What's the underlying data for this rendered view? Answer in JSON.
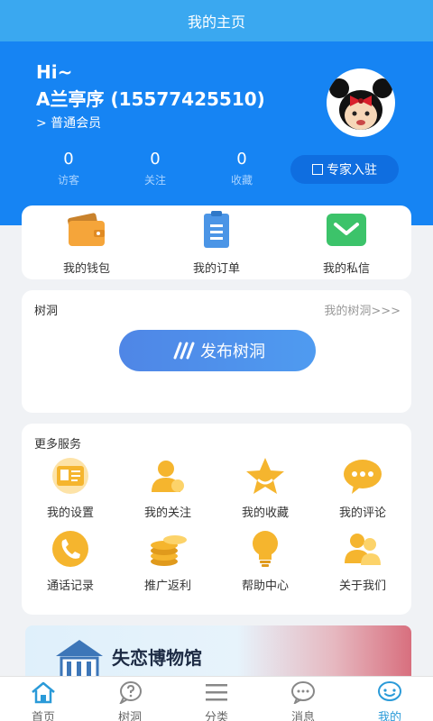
{
  "topbar": {
    "title": "我的主页"
  },
  "profile": {
    "greeting": "Hi~",
    "name": "A兰亭序 (15577425510)",
    "membership": "> 普通会员",
    "stats": [
      {
        "value": "0",
        "label": "访客"
      },
      {
        "value": "0",
        "label": "关注"
      },
      {
        "value": "0",
        "label": "收藏"
      }
    ],
    "expert_button": "专家入驻"
  },
  "quick": [
    {
      "label": "我的钱包",
      "icon": "wallet-icon"
    },
    {
      "label": "我的订单",
      "icon": "clipboard-icon"
    },
    {
      "label": "我的私信",
      "icon": "envelope-icon"
    }
  ],
  "treehole": {
    "title": "树洞",
    "link": "我的树洞>>>",
    "publish_button": "发布树洞"
  },
  "services": {
    "title": "更多服务",
    "items": [
      {
        "label": "我的设置",
        "icon": "id-card-icon"
      },
      {
        "label": "我的关注",
        "icon": "user-icon"
      },
      {
        "label": "我的收藏",
        "icon": "star-icon"
      },
      {
        "label": "我的评论",
        "icon": "comment-icon"
      },
      {
        "label": "通话记录",
        "icon": "phone-icon"
      },
      {
        "label": "推广返利",
        "icon": "coins-icon"
      },
      {
        "label": "帮助中心",
        "icon": "lightbulb-icon"
      },
      {
        "label": "关于我们",
        "icon": "users-icon"
      }
    ]
  },
  "banner": {
    "title": "失恋博物馆"
  },
  "tabs": [
    {
      "label": "首页",
      "icon": "home-icon"
    },
    {
      "label": "树洞",
      "icon": "question-bubble-icon"
    },
    {
      "label": "分类",
      "icon": "list-icon"
    },
    {
      "label": "消息",
      "icon": "message-icon"
    },
    {
      "label": "我的",
      "icon": "profile-icon",
      "active": true
    }
  ],
  "colors": {
    "header": "#1684f3",
    "topbar": "#3aa8f0",
    "accent": "#2a9ad8",
    "gold": "#f5b52e"
  }
}
